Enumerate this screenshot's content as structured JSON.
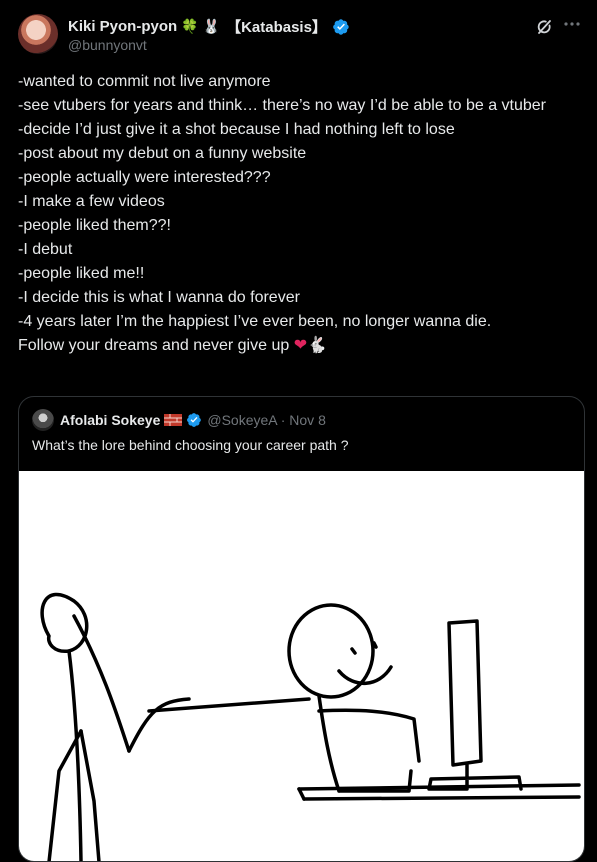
{
  "author": {
    "display_name": "Kiki Pyon-pyon",
    "emoji_clover": "🍀",
    "emoji_bunny": "🐰",
    "tag": "【Katabasis】",
    "handle": "@bunnyonvt",
    "avatar_icon": "avatar",
    "verified_color": "#1d9bf0"
  },
  "tweet": {
    "lines": [
      "-wanted to commit not live anymore",
      "-see vtubers for years and think… there’s no way I’d be able to be a vtuber",
      "-decide I’d just give it a shot because I had nothing left to lose",
      "-post about my debut on a funny website",
      "-people actually were interested???",
      "-I make a few videos",
      "-people liked them??!",
      "-I debut",
      "-people liked me!!",
      "-I decide this is what I wanna do forever",
      "-4 years later I’m the happiest I’ve ever been, no longer wanna die.",
      "Follow your dreams and never give up"
    ],
    "end_emoji_heart": "❤",
    "end_emoji_rabbit": "🐇"
  },
  "quote": {
    "display_name": "Afolabi Sokeye",
    "handle_date": "@SokeyeA · Nov 8",
    "text": "What’s the lore behind choosing your career path ?",
    "image_desc_icon": "stick-figure-drawing"
  },
  "actions": {
    "more_icon": "more-icon",
    "grok_icon": "grok-icon"
  }
}
